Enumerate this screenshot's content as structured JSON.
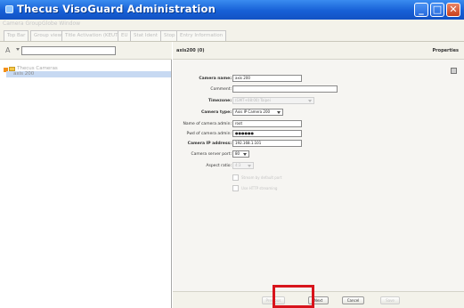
{
  "window": {
    "title": "Thecus VisoGuard Administration",
    "controls": {
      "minimize": "_",
      "maximize": "□",
      "close": "✕"
    }
  },
  "menu": {
    "items": [
      "Camera Group",
      "Globe Window"
    ]
  },
  "tabs": [
    "Top Bar",
    "Group view",
    "Title Activation (KEUT)",
    "EU",
    "Stat Ident",
    "Stop",
    "Entry Information"
  ],
  "sidebar": {
    "root": "Thecus Cameras",
    "child": "axis 200"
  },
  "panel": {
    "title": "axis200 (0)",
    "properties": "Properties"
  },
  "form": {
    "camera_name": {
      "label": "Camera name:",
      "value": "axis 200"
    },
    "comment": {
      "label": "Comment:",
      "value": ""
    },
    "timezone": {
      "label": "Timezone:",
      "value": "(GMT+08:00) Taipei"
    },
    "camera_type": {
      "label": "Camera type:",
      "value": "Axis IP Camera 200"
    },
    "admin_name": {
      "label": "Name of camera admin:",
      "value": "root"
    },
    "admin_pass": {
      "label": "Pwd of camera admin:",
      "value": "●●●●●●"
    },
    "ip_address": {
      "label": "Camera IP address:",
      "value": "192.168.1.101"
    },
    "server_port": {
      "label": "Camera server port:",
      "value": "80"
    },
    "aspect_ratio": {
      "label": "Aspect ratio:",
      "value": "4:3"
    },
    "checkbox1": "Stream by default port",
    "checkbox2": "Use HTTP streaming"
  },
  "buttons": {
    "previous": "Previous",
    "next": "Next",
    "cancel": "Cancel",
    "save": "Save"
  },
  "colors": {
    "titlebar": "#1760d6",
    "highlight": "#d8141c",
    "tree_selection": "#c7d9f2"
  }
}
